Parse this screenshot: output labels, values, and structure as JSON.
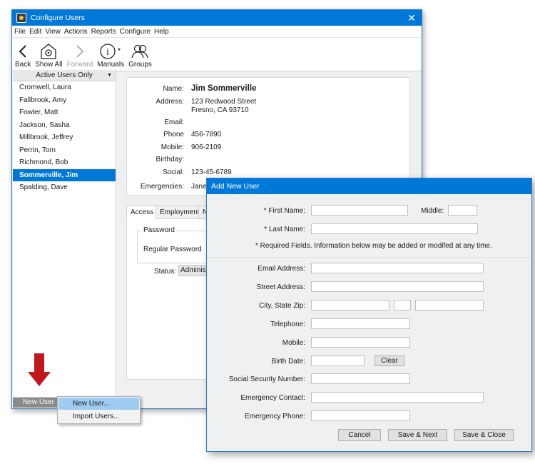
{
  "window": {
    "title": "Configure Users",
    "close_icon": "close-icon"
  },
  "menu": [
    "File",
    "Edit",
    "View",
    "Actions",
    "Reports",
    "Configure",
    "Help"
  ],
  "toolbar": {
    "back": "Back",
    "show_all": "Show All",
    "forward": "Forward",
    "manuals": "Manuals",
    "groups": "Groups"
  },
  "sidebar": {
    "filter_label": "Active Users Only",
    "users": [
      "Cromwell, Laura",
      "Fallbrook, Amy",
      "Fowler, Matt",
      "Jackson, Sasha",
      "Millbrook, Jeffrey",
      "Perrin, Tom",
      "Richmond, Bob",
      "Sommerville, Jim",
      "Spalding, Dave"
    ],
    "selected_user": "Sommerville, Jim",
    "new_user_button": "New User"
  },
  "details": {
    "name_label": "Name:",
    "name": "Jim Sommerville",
    "address_label": "Address:",
    "address_line1": "123 Redwood Street",
    "address_line2": "Fresno, CA 93710",
    "email_label": "Email:",
    "email": "",
    "phone_label": "Phone",
    "phone": "456-7890",
    "mobile_label": "Mobile:",
    "mobile": "906-2109",
    "birthday_label": "Birthday:",
    "birthday": "",
    "social_label": "Social:",
    "social": "123-45-6789",
    "emergencies_label": "Emergencies:",
    "emergencies": "Jane"
  },
  "tabs": {
    "items": [
      "Access",
      "Employment",
      "N"
    ],
    "active": "Access",
    "password_group": "Password",
    "password_type": "Regular Password",
    "status_label": "Status:",
    "status_value": "Administrator"
  },
  "context_menu": {
    "items": [
      "New User...",
      "Import Users..."
    ],
    "highlighted": "New User..."
  },
  "dialog": {
    "title": "Add New User",
    "first_name_label": "* First Name:",
    "middle_label": "Middle:",
    "last_name_label": "* Last Name:",
    "note": "* Required Fields.  Information below may be added or modifed at any time.",
    "email_label": "Email Address:",
    "street_label": "Street Address:",
    "city_label": "City, State Zip:",
    "telephone_label": "Telephone:",
    "mobile_label": "Mobile:",
    "birth_label": "Birth Date:",
    "clear_button": "Clear",
    "ssn_label": "Social Security Number:",
    "emergency_contact_label": "Emergency Contact:",
    "emergency_phone_label": "Emergency Phone:",
    "cancel_button": "Cancel",
    "save_next_button": "Save & Next",
    "save_close_button": "Save & Close",
    "values": {
      "first_name": "",
      "middle": "",
      "last_name": "",
      "email": "",
      "street": "",
      "city": "",
      "state": "",
      "zip": "",
      "telephone": "",
      "mobile": "",
      "birth": "",
      "ssn": "",
      "emergency_contact": "",
      "emergency_phone": ""
    }
  },
  "colors": {
    "accent": "#0078d7",
    "arrow": "#c0181c",
    "menu_highlight": "#9ecbf2"
  }
}
